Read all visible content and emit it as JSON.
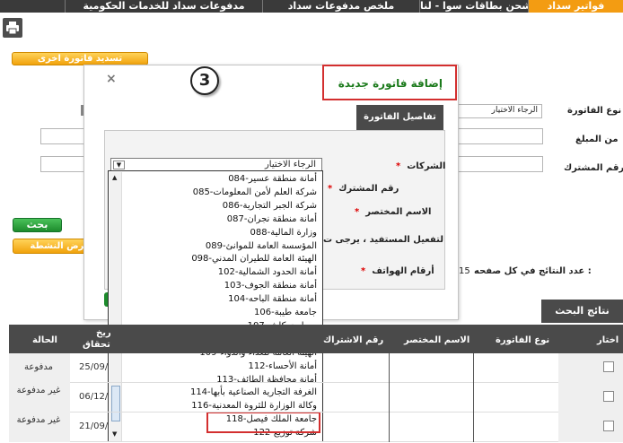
{
  "tabs": [
    {
      "label": "فواتير سداد",
      "active": true
    },
    {
      "label": "شحن بطاقات سوا - لنا",
      "active": false
    },
    {
      "label": "ملخص مدفوعات سداد",
      "active": false
    },
    {
      "label": "مدفوعات سداد للخدمات الحكومية",
      "active": false
    }
  ],
  "toolbar": {
    "pay_other_bill": "تسديد فاتورة اخرى"
  },
  "form": {
    "bill_type_label": "نوع الفاتورة",
    "bill_type_value": "الرجاء الاختيار",
    "amount_label": "من المبلغ",
    "subscriber_label": "رقم المشترك",
    "search_button": "بحث",
    "show_label": "عرض النشطة",
    "per_page_label": "عدد النتائج في كل صفحه :",
    "per_page_value": "15"
  },
  "modal": {
    "step_number": "3",
    "title": "إضافة فاتورة جديدة",
    "details_tab": "تفاصيل الفاتورة",
    "companies_label": "الشركات",
    "subscriber_label": "رقم المشترك",
    "short_name_label": "الاسم المختصر",
    "beneficiary_text": "لتفعيل المستفيد ، يرجى ت",
    "phones_label": "أرقام الهواتف",
    "select_value": "الرجاء الاختيار",
    "close_label": "×",
    "options": [
      "084-أمانة منطقة عسير",
      "085-شركة العلم لأمن المعلومات",
      "086-شركة الجبر التجارية",
      "087-أمانة منطقة نجران",
      "088-وزارة المالية",
      "089-المؤسسة العامة للموانئ",
      "098-الهيئة العامة للطيران المدني",
      "102-أمانة الحدود الشمالية",
      "103-أمانة منطقة الجوف",
      "104-أمانة منطقة الباحه",
      "106-جامعة طيبة",
      "107-سمارت كاش",
      "108-الهيئة العامة للاستثمار",
      "109-الهيئة العامة للغذاء والدواء",
      "112-أمانة الأحساء",
      "113-أمانة محافظة الطائف",
      "114-الغرفة التجارية الصناعية بأبها",
      "116-وكالة الوزارة للثروة المعدنية",
      "118-جامعة الملك فيصل",
      "122-شركة توزيع"
    ],
    "highlighted_index": 18
  },
  "results": {
    "tab_label": "نتائج البحث",
    "columns": {
      "select": "اختار",
      "bill_type": "نوع الفاتورة",
      "short_name": "الاسم المختصر",
      "subscriber": "رقم الاشتراك",
      "due_date_1": "ريخ",
      "due_date_2": "تحقاق",
      "status": "الحالة"
    },
    "rows": [
      {
        "date": "25/09/",
        "status": "مدفوعة"
      },
      {
        "date": "06/12/",
        "status": "غير مدفوعة"
      },
      {
        "date": "21/09/",
        "status": "غير مدفوعة"
      }
    ]
  },
  "colors": {
    "tab_active": "#f39c12",
    "tab_bar": "#3a3a3a",
    "highlight": "#d32f2f",
    "title_green": "#1b7a1b"
  }
}
